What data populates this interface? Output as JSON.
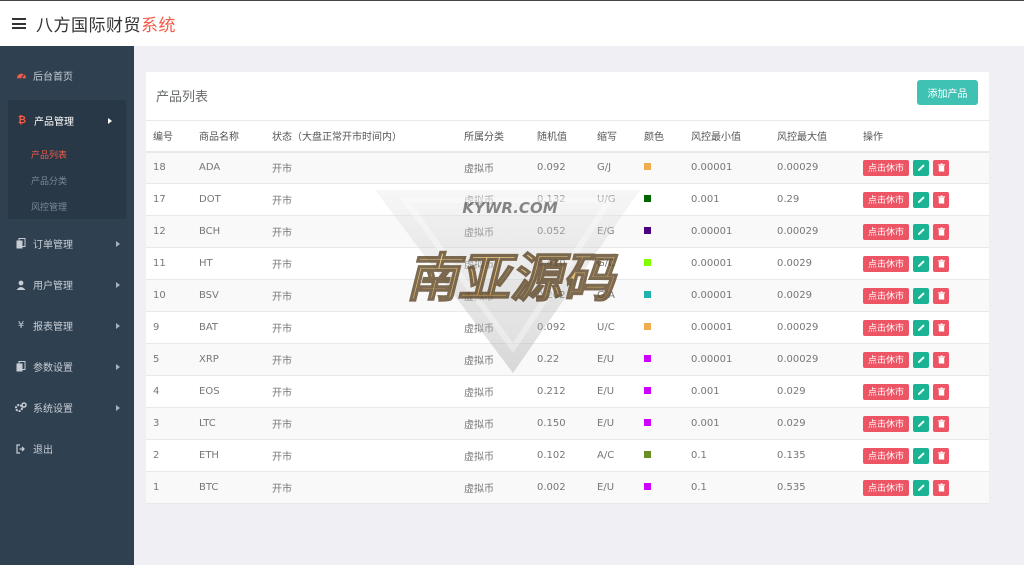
{
  "header": {
    "title_main": "八方国际财贸",
    "title_accent": "系统"
  },
  "sidebar": {
    "items": [
      {
        "label": "后台首页",
        "icon": "dashboard-icon"
      },
      {
        "label": "产品管理",
        "icon": "bitcoin-icon"
      },
      {
        "label": "订单管理",
        "icon": "copy-icon"
      },
      {
        "label": "用户管理",
        "icon": "user-icon"
      },
      {
        "label": "报表管理",
        "icon": "yen-icon"
      },
      {
        "label": "参数设置",
        "icon": "copy-icon"
      },
      {
        "label": "系统设置",
        "icon": "gears-icon"
      },
      {
        "label": "退出",
        "icon": "sign-out-icon"
      }
    ],
    "sub_items": [
      {
        "label": "产品列表"
      },
      {
        "label": "产品分类"
      },
      {
        "label": "风控管理"
      }
    ]
  },
  "panel": {
    "title": "产品列表",
    "add_label": "添加产品"
  },
  "table": {
    "headers": [
      "编号",
      "商品名称",
      "状态（大盘正常开市时间内）",
      "所属分类",
      "随机值",
      "缩写",
      "颜色",
      "风控最小值",
      "风控最大值",
      "操作"
    ],
    "action_label": "点击休市",
    "rows": [
      {
        "id": "18",
        "name": "ADA",
        "status": "开市",
        "category": "虚拟币",
        "random": "0.092",
        "abbr": "G/J",
        "color": "#f0ad4e",
        "min": "0.00001",
        "max": "0.00029"
      },
      {
        "id": "17",
        "name": "DOT",
        "status": "开市",
        "category": "虚拟币",
        "random": "0.132",
        "abbr": "U/G",
        "color": "#006400",
        "min": "0.001",
        "max": "0.29"
      },
      {
        "id": "12",
        "name": "BCH",
        "status": "开市",
        "category": "虚拟币",
        "random": "0.052",
        "abbr": "E/G",
        "color": "#4b0082",
        "min": "0.00001",
        "max": "0.00029"
      },
      {
        "id": "11",
        "name": "HT",
        "status": "开市",
        "category": "虚拟币",
        "random": "0.410",
        "abbr": "G/C",
        "color": "#7fff00",
        "min": "0.00001",
        "max": "0.0029"
      },
      {
        "id": "10",
        "name": "BSV",
        "status": "开市",
        "category": "虚拟币",
        "random": "0.202",
        "abbr": "G/A",
        "color": "#20b2aa",
        "min": "0.00001",
        "max": "0.0029"
      },
      {
        "id": "9",
        "name": "BAT",
        "status": "开市",
        "category": "虚拟币",
        "random": "0.092",
        "abbr": "U/C",
        "color": "#f0ad4e",
        "min": "0.00001",
        "max": "0.00029"
      },
      {
        "id": "5",
        "name": "XRP",
        "status": "开市",
        "category": "虚拟币",
        "random": "0.22",
        "abbr": "E/U",
        "color": "#cc00ff",
        "min": "0.00001",
        "max": "0.00029"
      },
      {
        "id": "4",
        "name": "EOS",
        "status": "开市",
        "category": "虚拟币",
        "random": "0.212",
        "abbr": "E/U",
        "color": "#cc00ff",
        "min": "0.001",
        "max": "0.029"
      },
      {
        "id": "3",
        "name": "LTC",
        "status": "开市",
        "category": "虚拟币",
        "random": "0.150",
        "abbr": "E/U",
        "color": "#cc00ff",
        "min": "0.001",
        "max": "0.029"
      },
      {
        "id": "2",
        "name": "ETH",
        "status": "开市",
        "category": "虚拟币",
        "random": "0.102",
        "abbr": "A/C",
        "color": "#6b8e23",
        "min": "0.1",
        "max": "0.135"
      },
      {
        "id": "1",
        "name": "BTC",
        "status": "开市",
        "category": "虚拟币",
        "random": "0.002",
        "abbr": "E/U",
        "color": "#cc00ff",
        "min": "0.1",
        "max": "0.535"
      }
    ]
  },
  "watermark": {
    "line1": "KYWR.COM",
    "line2": "南亚源码"
  },
  "colors": {
    "accent": "#f25b4a",
    "sidebar": "#2f4050",
    "primary": "#3fc2b4",
    "danger": "#ed5565",
    "success": "#1ab394"
  }
}
